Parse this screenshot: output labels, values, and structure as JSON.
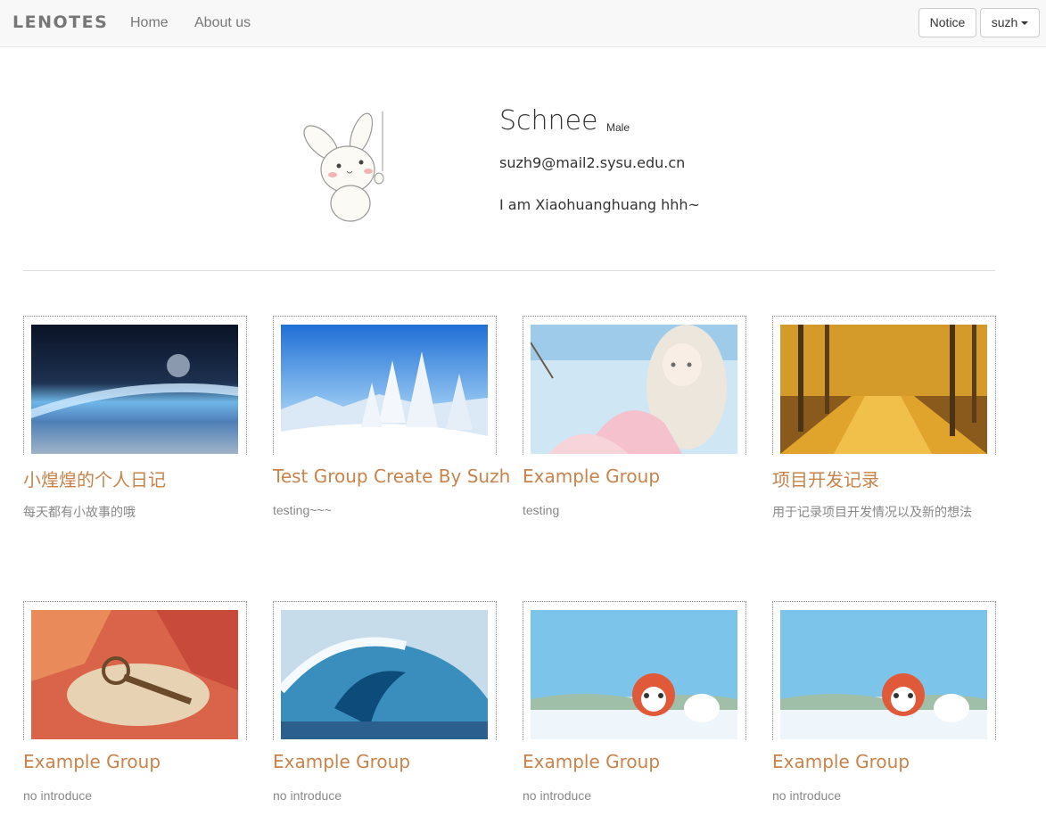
{
  "navbar": {
    "brand": "LENOTES",
    "home_label": "Home",
    "about_label": "About us",
    "notice_label": "Notice",
    "user_label": "suzh"
  },
  "profile": {
    "name": "Schnee",
    "gender": "Male",
    "email": "suzh9@mail2.sysu.edu.cn",
    "bio": "I am Xiaohuanghuang hhh~"
  },
  "groups": [
    {
      "title": "小煌煌的个人日记",
      "description": "每天都有小故事的哦",
      "image": "earth-from-space"
    },
    {
      "title": "Test Group Create By Suzh",
      "description": "testing~~~",
      "image": "snowy-trees"
    },
    {
      "title": "Example Group",
      "description": "testing",
      "image": "anime-girl"
    },
    {
      "title": "项目开发记录",
      "description": "用于记录项目开发情况以及新的想法",
      "image": "autumn-forest-path"
    },
    {
      "title": "Example Group",
      "description": "no introduce",
      "image": "key-on-leaves"
    },
    {
      "title": "Example Group",
      "description": "no introduce",
      "image": "ocean-wave"
    },
    {
      "title": "Example Group",
      "description": "no introduce",
      "image": "cartoon-fox-sky"
    },
    {
      "title": "Example Group",
      "description": "no introduce",
      "image": "cartoon-fox-sky"
    }
  ]
}
